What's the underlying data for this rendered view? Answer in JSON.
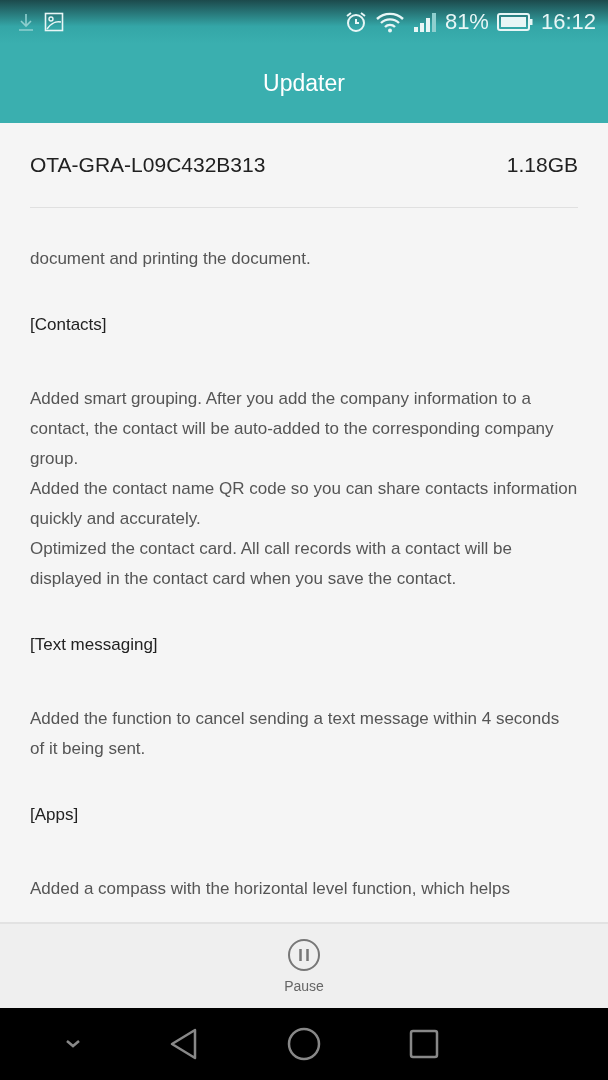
{
  "status_bar": {
    "battery_percent": "81%",
    "time": "16:12"
  },
  "app_bar": {
    "title": "Updater"
  },
  "package": {
    "name": "OTA-GRA-L09C432B313",
    "size": "1.18GB"
  },
  "notes": [
    {
      "kind": "text",
      "text": "document and printing the document."
    },
    {
      "kind": "heading",
      "text": "[Contacts]"
    },
    {
      "kind": "text",
      "text": "Added smart grouping. After you add the company information to a contact, the contact will be auto-added to the corresponding company group."
    },
    {
      "kind": "text",
      "text": "Added the contact name QR code so you can share contacts information quickly and accurately."
    },
    {
      "kind": "text",
      "text": "Optimized the contact card. All call records with a contact will be displayed in the contact card when you save the contact."
    },
    {
      "kind": "heading",
      "text": "[Text messaging]"
    },
    {
      "kind": "text",
      "text": "Added the function to cancel sending a text message within 4 seconds of it being sent."
    },
    {
      "kind": "heading",
      "text": "[Apps]"
    },
    {
      "kind": "text",
      "text": "Added a compass with the horizontal level function, which helps"
    }
  ],
  "bottom_action": {
    "label": "Pause"
  }
}
